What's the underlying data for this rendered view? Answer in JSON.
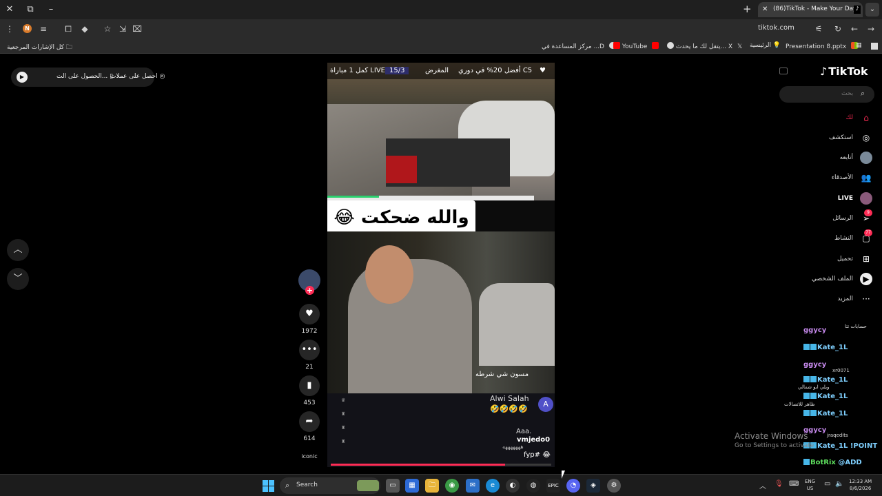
{
  "browser": {
    "tab_title": "(86)TikTok - Make Your Day",
    "url": "tiktok.com",
    "profile_initial": "N",
    "bookmarks": [
      {
        "label": "Presentation 8.pptx",
        "color": "#d9a800"
      },
      {
        "label": "الرئيسية",
        "color": "#ffd34a"
      },
      {
        "label": "يتقل لك ما يحدث... X",
        "color": "#ffffff"
      },
      {
        "label": "YouTube",
        "color": "#ff0000"
      },
      {
        "label": "مركز المساعدة في ...D",
        "color": "#ffffff"
      }
    ],
    "all_bookmarks": "كل الإشارات المرجعية"
  },
  "promo": {
    "get_coins": "احصل على عملات",
    "get_app": "الحصول على الت..."
  },
  "video": {
    "scoreboard": {
      "left": "أفضل 20% في دوري C5",
      "mid": "المغرض",
      "fraction": "15/3",
      "right": "كمل 1 مباراة LIVE"
    },
    "caption": "😂 والله ضحكت",
    "stream_text": "مسون شي شرطه",
    "overlay_name": "Alwi Salah",
    "overlay_emoji": "🤣🤣🤣🤣",
    "avatar_letter": "A",
    "chat_aaa": "Aaa.",
    "chat_sub": "هههههههه",
    "username": "vmjedo0",
    "tag": "fyp#",
    "tag_emoji": "😂",
    "progress": 0.79
  },
  "actions": {
    "likes": "1972",
    "comments": "21",
    "saves": "453",
    "shares": "614",
    "sound": "iconic"
  },
  "sidebar": {
    "logo": "TikTok",
    "search_placeholder": "بحث",
    "items": [
      {
        "label": "لك",
        "icon": "home-icon",
        "active": true
      },
      {
        "label": "استكشف",
        "icon": "compass-icon"
      },
      {
        "label": "أتابعه",
        "icon": "avatar-icon"
      },
      {
        "label": "الأصدقاء",
        "icon": "friends-icon"
      },
      {
        "label": "LIVE",
        "icon": "live-icon"
      },
      {
        "label": "الرسائل",
        "icon": "send-icon",
        "badge": "9"
      },
      {
        "label": "النشاط",
        "icon": "inbox-icon",
        "badge": "77"
      },
      {
        "label": "تحميل",
        "icon": "plus-square-icon"
      },
      {
        "label": "الملف الشخصي",
        "icon": "profile-icon"
      },
      {
        "label": "المزيد",
        "icon": "more-icon"
      }
    ]
  },
  "overlay_chat": [
    {
      "name": "ggycy",
      "msg": "حسابات تتا",
      "color": "#c98cf0"
    },
    {
      "name": "Kate_1L",
      "msg": "",
      "color": "#7fd0ff"
    },
    {
      "name": "ggycy",
      "msg": "xr0071",
      "color": "#c98cf0"
    },
    {
      "name": "Kate_1L",
      "msg": "ويلي ابو شمالي",
      "color": "#7fd0ff"
    },
    {
      "name": "Kate_1L",
      "msg": "ظاهر للاتصالات",
      "color": "#7fd0ff"
    },
    {
      "name": "Kate_1L",
      "msg": "",
      "color": "#7fd0ff"
    },
    {
      "name": "ggycy",
      "msg": "jraqedits",
      "color": "#c98cf0"
    },
    {
      "name": "Kate_1L",
      "msg": "!POINT",
      "color": "#7fd0ff"
    },
    {
      "name": "BotRix",
      "msg": "@ADD",
      "color": "#5fe05f"
    }
  ],
  "activate": {
    "line1": "Activate Windows",
    "line2": "Go to Settings to activate"
  },
  "taskbar": {
    "search": "Search",
    "lang1": "ENG",
    "lang2": "US",
    "time": "12:33 AM",
    "date": "8/6/2026"
  }
}
